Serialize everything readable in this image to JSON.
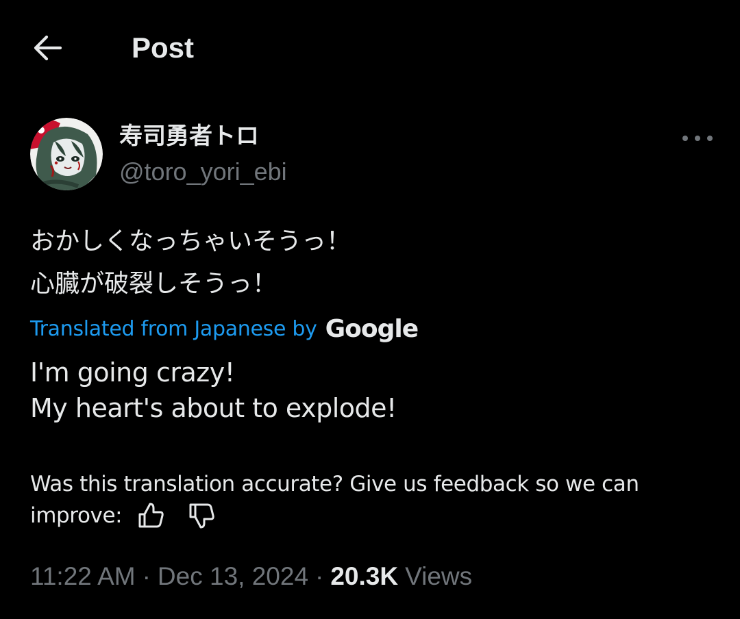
{
  "header": {
    "title": "Post",
    "back_icon": "arrow-left-icon"
  },
  "author": {
    "display_name": "寿司勇者トロ",
    "handle": "@toro_yori_ebi",
    "more_icon": "more-horizontal-icon"
  },
  "post": {
    "lines": [
      "おかしくなっちゃいそうっ！",
      "心臓が破裂しそうっ！"
    ]
  },
  "translation": {
    "label": "Translated from Japanese by",
    "provider": "Google",
    "lines": [
      "I'm going crazy!",
      "My heart's about to explode!"
    ]
  },
  "feedback": {
    "line1": "Was this translation accurate? Give us feedback so we can",
    "line2": "improve:",
    "thumbs_up_icon": "thumbs-up-icon",
    "thumbs_down_icon": "thumbs-down-icon"
  },
  "meta": {
    "time": "11:22 AM",
    "separator": "·",
    "date": "Dec 13, 2024",
    "views_count": "20.3K",
    "views_label": "Views"
  },
  "colors": {
    "background": "#000000",
    "text_primary": "#e7e9ea",
    "text_secondary": "#71767b",
    "link": "#1d9bf0"
  }
}
